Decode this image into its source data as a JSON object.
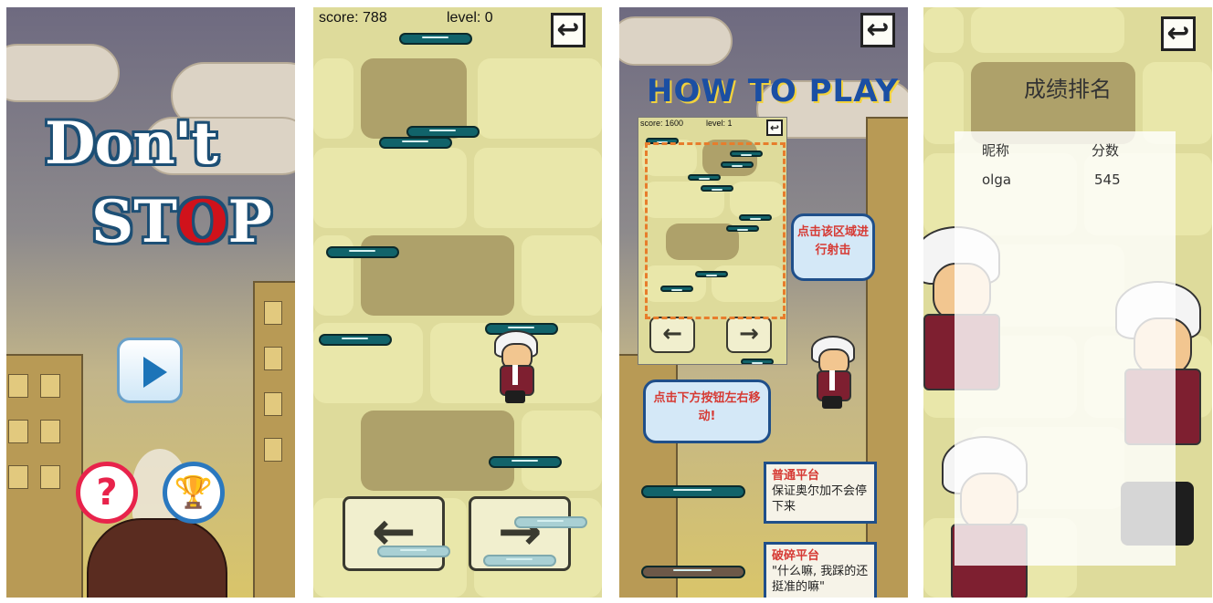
{
  "screen1": {
    "title_line1": "Don't",
    "title_line2_a": "ST",
    "title_line2_o": "O",
    "title_line2_b": "P",
    "help_glyph": "?",
    "play_icon": "play-icon",
    "rank_icon": "trophy-icon"
  },
  "screen2": {
    "score_label": "score: 788",
    "level_label": "level: 0",
    "back_glyph": "↩",
    "left_glyph": "←",
    "right_glyph": "→"
  },
  "screen3": {
    "how_to_play": "HOW TO PLAY",
    "mini_score": "score: 1600",
    "mini_level": "level: 1",
    "back_glyph": "↩",
    "left_glyph": "←",
    "right_glyph": "→",
    "bubble_shoot": "点击该区域进行射击",
    "bubble_move": "点击下方按钮左右移动!",
    "note_normal_title": "普通平台",
    "note_normal_text": "保证奥尔加不会停下来",
    "note_broken_title": "破碎平台",
    "note_broken_text": "\"什么嘛, 我踩的还挺准的嘛\""
  },
  "screen4": {
    "back_glyph": "↩",
    "title": "成绩排名",
    "col_name": "昵称",
    "col_score": "分数",
    "rows": [
      {
        "name": "olga",
        "score": "545"
      }
    ]
  }
}
